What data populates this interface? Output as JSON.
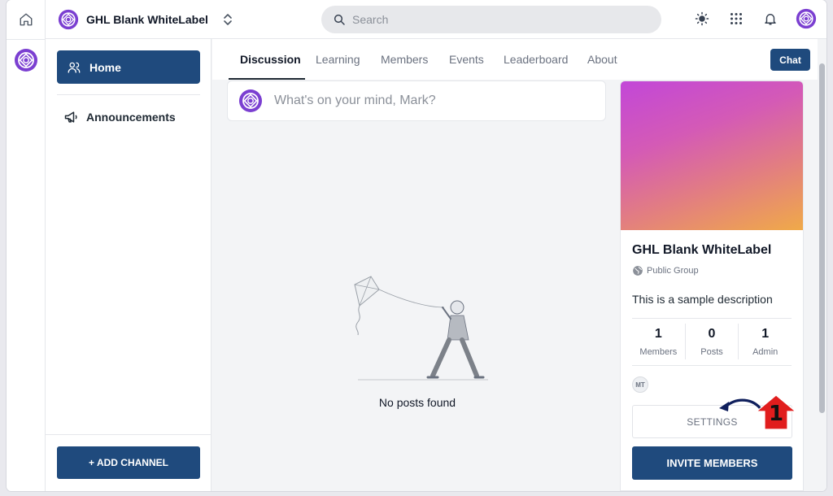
{
  "app": {
    "group_name": "GHL Blank WhiteLabel"
  },
  "topbar": {
    "search_placeholder": "Search",
    "icons": [
      "sun-icon",
      "apps-grid-icon",
      "bell-icon",
      "user-avatar"
    ]
  },
  "sidebar": {
    "items": [
      {
        "label": "Home",
        "icon": "users-icon",
        "active": true
      },
      {
        "label": "Announcements",
        "icon": "megaphone-icon",
        "active": false
      }
    ],
    "add_channel_label": "+ ADD CHANNEL"
  },
  "tabs": {
    "items": [
      {
        "label": "Discussion",
        "active": true
      },
      {
        "label": "Learning",
        "active": false
      },
      {
        "label": "Members",
        "active": false
      },
      {
        "label": "Events",
        "active": false
      },
      {
        "label": "Leaderboard",
        "active": false
      },
      {
        "label": "About",
        "active": false
      }
    ],
    "chat_label": "Chat"
  },
  "composer": {
    "placeholder": "What's on your mind, Mark?"
  },
  "feed": {
    "empty_text": "No posts found"
  },
  "group_card": {
    "title": "GHL Blank WhiteLabel",
    "privacy": "Public Group",
    "description": "This is a sample description",
    "stats": [
      {
        "value": "1",
        "label": "Members"
      },
      {
        "value": "0",
        "label": "Posts"
      },
      {
        "value": "1",
        "label": "Admin"
      }
    ],
    "member_initials": "MT",
    "settings_label": "SETTINGS",
    "invite_label": "INVITE MEMBERS"
  },
  "annotation": {
    "step_number": "1"
  },
  "colors": {
    "primary": "#1f4a7d",
    "logo_purple": "#7b3fd1",
    "cover_start": "#c247d8",
    "cover_end": "#f0aa48",
    "annotation_red": "#e11d1d"
  }
}
